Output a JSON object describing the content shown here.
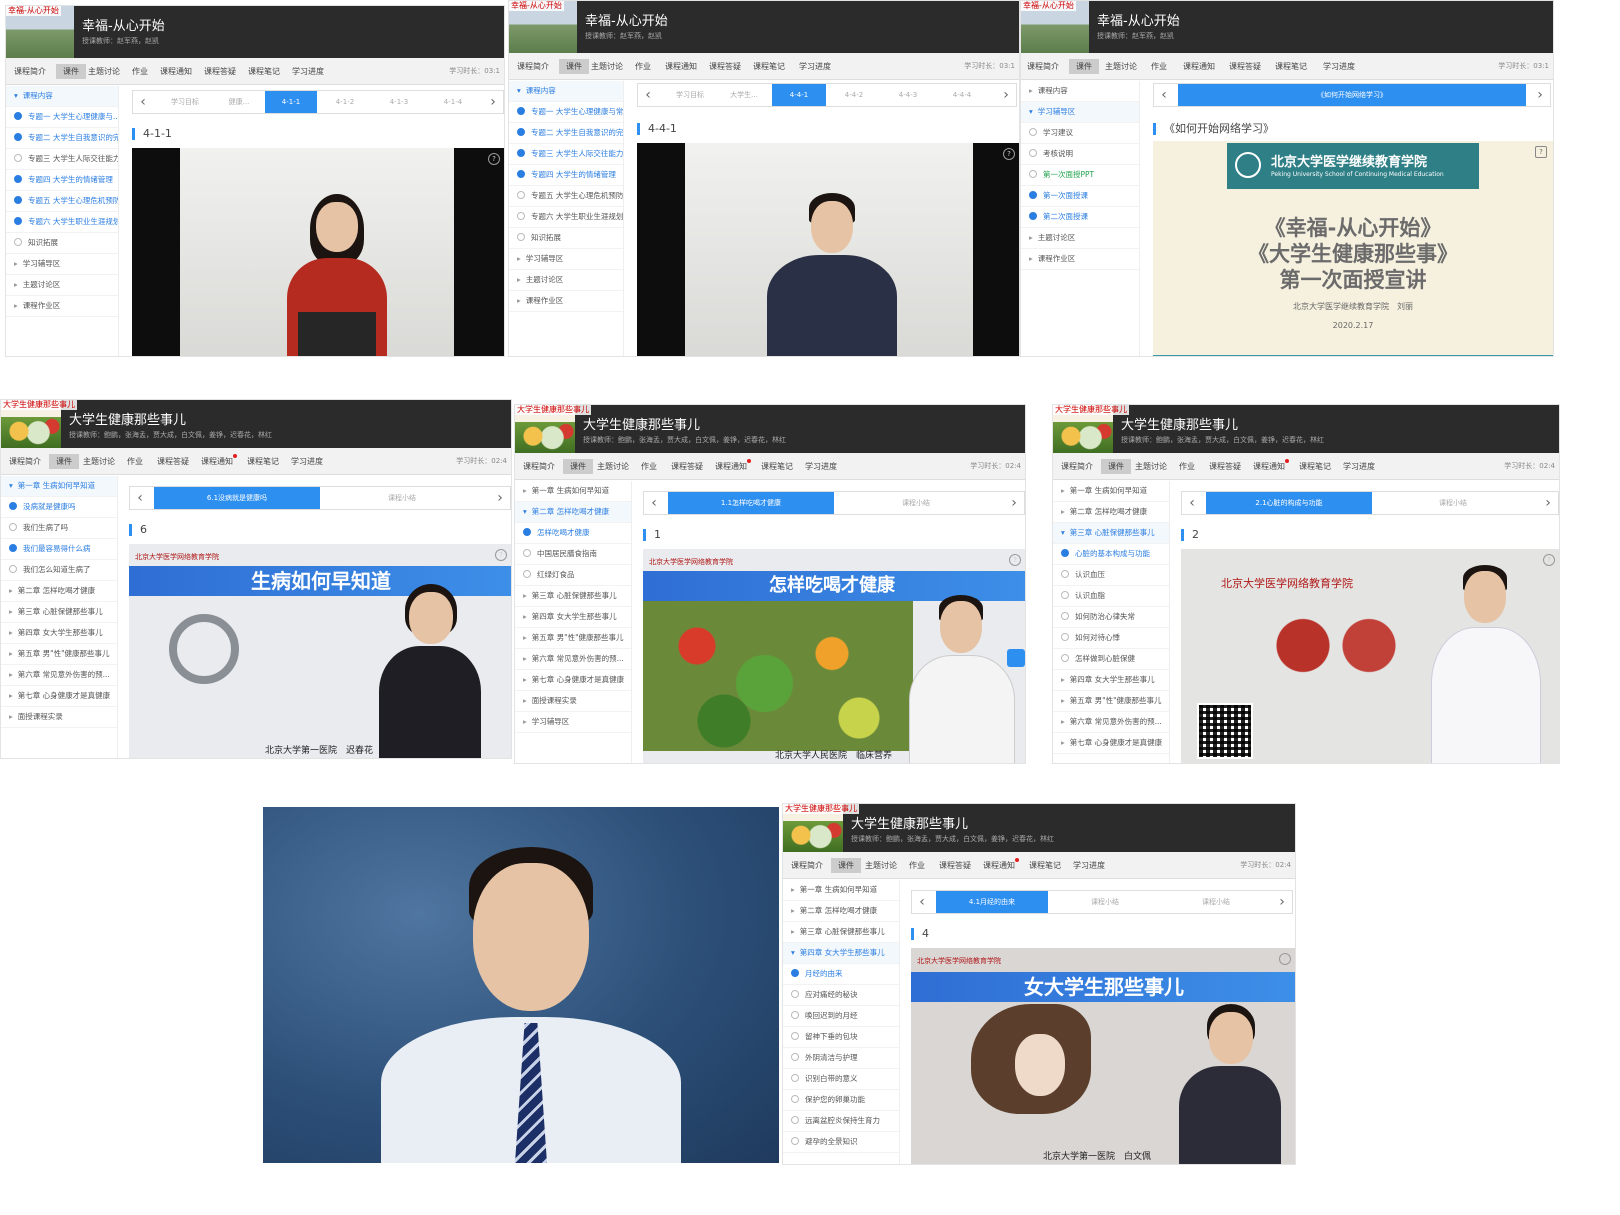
{
  "course1": {
    "title": "幸福-从心开始",
    "thumb_label": "幸福-从心开始",
    "teachers": "授课教师：赵军燕，赵凯",
    "nav": [
      "课程简介",
      "课件",
      "主题讨论",
      "作业",
      "课程通知",
      "课程答疑",
      "课程笔记",
      "学习进度"
    ],
    "time_label": "学习时长：03:1"
  },
  "course2": {
    "title": "大学生健康那些事儿",
    "thumb_label": "大学生健康那些事儿",
    "teachers": "授课教师：鲍鹏，张海孟，贾大成，白文佩，姜铮，迟春花，林红",
    "nav": [
      "课程简介",
      "课件",
      "主题讨论",
      "作业",
      "课程答疑",
      "课程通知",
      "课程笔记",
      "学习进度"
    ],
    "time_label": "学习时长：02:4"
  },
  "panel1": {
    "sidebar": [
      {
        "label": "课程内容",
        "kind": "open"
      },
      {
        "label": "专题一 大学生心理健康与...",
        "kind": "sub cur hl"
      },
      {
        "label": "专题二 大学生自我意识的完善",
        "kind": "sub cur"
      },
      {
        "label": "专题三 大学生人际交往能力...",
        "kind": "sub"
      },
      {
        "label": "专题四 大学生的情绪管理",
        "kind": "sub cur"
      },
      {
        "label": "专题五 大学生心理危机预防...",
        "kind": "sub cur"
      },
      {
        "label": "专题六 大学生职业生涯规划",
        "kind": "sub cur"
      },
      {
        "label": "知识拓展",
        "kind": "sub"
      },
      {
        "label": "学习辅导区",
        "kind": "main"
      },
      {
        "label": "主题讨论区",
        "kind": "main"
      },
      {
        "label": "课程作业区",
        "kind": "main"
      }
    ],
    "tabs": [
      "学习目标",
      "健康...",
      "4-1-1",
      "4-1-2",
      "4-1-3",
      "4-1-4"
    ],
    "lesson_label": "4-1-1"
  },
  "panel2": {
    "sidebar": [
      {
        "label": "课程内容",
        "kind": "open"
      },
      {
        "label": "专题一 大学生心理健康与常...",
        "kind": "sub cur"
      },
      {
        "label": "专题二 大学生自我意识的完善",
        "kind": "sub cur"
      },
      {
        "label": "专题三 大学生人际交往能力...",
        "kind": "sub cur"
      },
      {
        "label": "专题四 大学生的情绪管理",
        "kind": "sub cur hl"
      },
      {
        "label": "专题五 大学生心理危机预防...",
        "kind": "sub"
      },
      {
        "label": "专题六 大学生职业生涯规划",
        "kind": "sub"
      },
      {
        "label": "知识拓展",
        "kind": "sub"
      },
      {
        "label": "学习辅导区",
        "kind": "main"
      },
      {
        "label": "主题讨论区",
        "kind": "main"
      },
      {
        "label": "课程作业区",
        "kind": "main"
      }
    ],
    "tabs": [
      "学习目标",
      "大学生...",
      "4-4-1",
      "4-4-2",
      "4-4-3",
      "4-4-4"
    ],
    "lesson_label": "4-4-1"
  },
  "panel3": {
    "sidebar": [
      {
        "label": "课程内容",
        "kind": "main"
      },
      {
        "label": "学习辅导区",
        "kind": "open"
      },
      {
        "label": "学习建议",
        "kind": "sub"
      },
      {
        "label": "考核说明",
        "kind": "sub"
      },
      {
        "label": "第一次面授PPT",
        "kind": "sub hl"
      },
      {
        "label": "第一次面授课",
        "kind": "sub cur"
      },
      {
        "label": "第二次面授课",
        "kind": "sub cur hl"
      },
      {
        "label": "主题讨论区",
        "kind": "main"
      },
      {
        "label": "课程作业区",
        "kind": "main"
      }
    ],
    "tab": "《如何开始网络学习》",
    "lesson_label": "《如何开始网络学习》",
    "slide": {
      "school_cn": "北京大学医学继续教育学院",
      "school_en": "Peking University School of Continuing Medical Education",
      "line1": "《幸福-从心开始》",
      "line2": "《大学生健康那些事》",
      "line3": "第一次面授宣讲",
      "author": "北京大学医学继续教育学院　刘丽",
      "date": "2020.2.17"
    }
  },
  "panel4": {
    "sidebar": [
      {
        "label": "第一章 生病如何早知道",
        "kind": "open"
      },
      {
        "label": "没病就是健康吗",
        "kind": "sub cur"
      },
      {
        "label": "我们生病了吗",
        "kind": "sub"
      },
      {
        "label": "我们最容易得什么病",
        "kind": "sub cur"
      },
      {
        "label": "我们怎么知道生病了",
        "kind": "sub"
      },
      {
        "label": "第二章 怎样吃喝才健康",
        "kind": "main"
      },
      {
        "label": "第三章 心脏保健那些事儿",
        "kind": "main"
      },
      {
        "label": "第四章 女大学生那些事儿",
        "kind": "main"
      },
      {
        "label": "第五章 男\"性\"健康那些事儿",
        "kind": "main"
      },
      {
        "label": "第六章 常见意外伤害的预...",
        "kind": "main"
      },
      {
        "label": "第七章 心身健康才是真健康",
        "kind": "main"
      },
      {
        "label": "面授课程实录",
        "kind": "main"
      }
    ],
    "tabs": [
      "6.1没病就是健康吗",
      "课程小结"
    ],
    "lesson_label": "6",
    "video_logo": "北京大学医学网络教育学院",
    "video_title": "生病如何早知道",
    "caption": "北京大学第一医院　迟春花"
  },
  "panel5": {
    "sidebar": [
      {
        "label": "第一章 生病如何早知道",
        "kind": "main"
      },
      {
        "label": "第二章 怎样吃喝才健康",
        "kind": "open"
      },
      {
        "label": "怎样吃喝才健康",
        "kind": "sub cur"
      },
      {
        "label": "中国居民膳食指南",
        "kind": "sub"
      },
      {
        "label": "红绿灯食品",
        "kind": "sub"
      },
      {
        "label": "第三章 心脏保健那些事儿",
        "kind": "main"
      },
      {
        "label": "第四章 女大学生那些事儿",
        "kind": "main"
      },
      {
        "label": "第五章 男\"性\"健康那些事儿",
        "kind": "main"
      },
      {
        "label": "第六章 常见意外伤害的预...",
        "kind": "main"
      },
      {
        "label": "第七章 心身健康才是真健康",
        "kind": "main"
      },
      {
        "label": "面授课程实录",
        "kind": "main"
      },
      {
        "label": "学习辅导区",
        "kind": "main"
      }
    ],
    "tabs": [
      "1.1怎样吃喝才健康",
      "课程小结"
    ],
    "lesson_label": "1",
    "video_logo": "北京大学医学网络教育学院",
    "video_title": "怎样吃喝才健康",
    "caption": "北京大学人民医院　临床营养"
  },
  "panel6": {
    "sidebar": [
      {
        "label": "第一章 生病如何早知道",
        "kind": "main"
      },
      {
        "label": "第二章 怎样吃喝才健康",
        "kind": "main"
      },
      {
        "label": "第三章 心脏保健那些事儿",
        "kind": "open"
      },
      {
        "label": "心脏的基本构成与功能",
        "kind": "sub cur"
      },
      {
        "label": "认识血压",
        "kind": "sub"
      },
      {
        "label": "认识血脂",
        "kind": "sub"
      },
      {
        "label": "如何防治心律失常",
        "kind": "sub"
      },
      {
        "label": "如何对待心悸",
        "kind": "sub"
      },
      {
        "label": "怎样做到心脏保健",
        "kind": "sub"
      },
      {
        "label": "第四章 女大学生那些事儿",
        "kind": "main"
      },
      {
        "label": "第五章 男\"性\"健康那些事儿",
        "kind": "main"
      },
      {
        "label": "第六章 常见意外伤害的预...",
        "kind": "main"
      },
      {
        "label": "第七章 心身健康才是真健康",
        "kind": "main"
      }
    ],
    "tabs": [
      "2.1心脏的构成与功能",
      "课程小结"
    ],
    "lesson_label": "2",
    "video_logo": "北京大学医学网络教育学院"
  },
  "panel8": {
    "sidebar": [
      {
        "label": "第一章 生病如何早知道",
        "kind": "main"
      },
      {
        "label": "第二章 怎样吃喝才健康",
        "kind": "main"
      },
      {
        "label": "第三章 心脏保健那些事儿",
        "kind": "main"
      },
      {
        "label": "第四章 女大学生那些事儿",
        "kind": "open"
      },
      {
        "label": "月经的由来",
        "kind": "sub cur"
      },
      {
        "label": "应对痛经的秘诀",
        "kind": "sub"
      },
      {
        "label": "唤回迟到的月经",
        "kind": "sub"
      },
      {
        "label": "留神下垂的包块",
        "kind": "sub"
      },
      {
        "label": "外阴清洁与护理",
        "kind": "sub"
      },
      {
        "label": "识别白带的意义",
        "kind": "sub"
      },
      {
        "label": "保护您的卵巢功能",
        "kind": "sub"
      },
      {
        "label": "远离盆腔炎保持生育力",
        "kind": "sub"
      },
      {
        "label": "避孕的全景知识",
        "kind": "sub"
      }
    ],
    "tabs": [
      "4.1月经的由来",
      "课程小结",
      "课程小结"
    ],
    "lesson_label": "4",
    "video_logo": "北京大学医学网络教育学院",
    "video_title": "女大学生那些事儿",
    "caption": "北京大学第一医院　白文佩"
  }
}
